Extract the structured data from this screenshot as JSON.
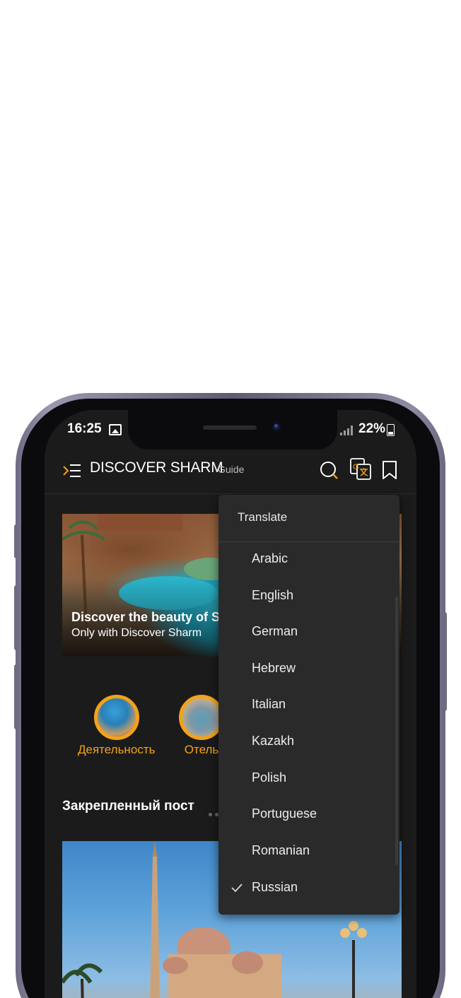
{
  "status_bar": {
    "time": "16:25",
    "battery": "22%"
  },
  "app_bar": {
    "title": "DISCOVER SHARM",
    "subtitle": "Guide"
  },
  "hero": {
    "title": "Discover the beauty of S",
    "subtitle": "Only with Discover Sharm"
  },
  "categories": [
    {
      "label": "Деятельность"
    },
    {
      "label": "Отель"
    }
  ],
  "section": {
    "title": "Закрепленный пост"
  },
  "dropdown": {
    "title": "Translate",
    "selected": "Russian",
    "items": [
      {
        "label": "Arabic"
      },
      {
        "label": "English"
      },
      {
        "label": "German"
      },
      {
        "label": "Hebrew"
      },
      {
        "label": "Italian"
      },
      {
        "label": "Kazakh"
      },
      {
        "label": "Polish"
      },
      {
        "label": "Portuguese"
      },
      {
        "label": "Romanian"
      },
      {
        "label": "Russian"
      }
    ]
  },
  "colors": {
    "accent": "#f3a21a",
    "background": "#1b1b1b",
    "menu": "#2a2a2a"
  },
  "icons": [
    "menu-icon",
    "search-icon",
    "translate-icon",
    "bookmark-icon",
    "check-icon"
  ]
}
